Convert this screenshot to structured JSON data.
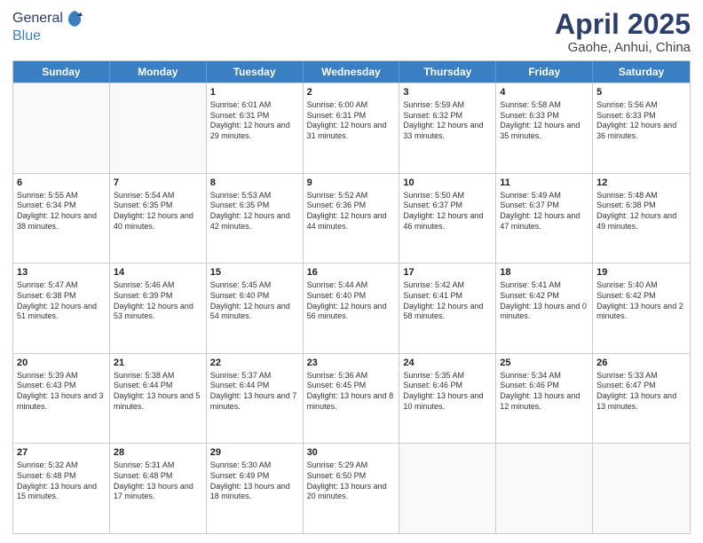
{
  "header": {
    "logo": {
      "general": "General",
      "blue": "Blue"
    },
    "title": "April 2025",
    "location": "Gaohe, Anhui, China"
  },
  "calendar": {
    "days": [
      "Sunday",
      "Monday",
      "Tuesday",
      "Wednesday",
      "Thursday",
      "Friday",
      "Saturday"
    ],
    "rows": [
      [
        {
          "day": "",
          "empty": true
        },
        {
          "day": "",
          "empty": true
        },
        {
          "day": "1",
          "sunrise": "Sunrise: 6:01 AM",
          "sunset": "Sunset: 6:31 PM",
          "daylight": "Daylight: 12 hours and 29 minutes."
        },
        {
          "day": "2",
          "sunrise": "Sunrise: 6:00 AM",
          "sunset": "Sunset: 6:31 PM",
          "daylight": "Daylight: 12 hours and 31 minutes."
        },
        {
          "day": "3",
          "sunrise": "Sunrise: 5:59 AM",
          "sunset": "Sunset: 6:32 PM",
          "daylight": "Daylight: 12 hours and 33 minutes."
        },
        {
          "day": "4",
          "sunrise": "Sunrise: 5:58 AM",
          "sunset": "Sunset: 6:33 PM",
          "daylight": "Daylight: 12 hours and 35 minutes."
        },
        {
          "day": "5",
          "sunrise": "Sunrise: 5:56 AM",
          "sunset": "Sunset: 6:33 PM",
          "daylight": "Daylight: 12 hours and 36 minutes."
        }
      ],
      [
        {
          "day": "6",
          "sunrise": "Sunrise: 5:55 AM",
          "sunset": "Sunset: 6:34 PM",
          "daylight": "Daylight: 12 hours and 38 minutes."
        },
        {
          "day": "7",
          "sunrise": "Sunrise: 5:54 AM",
          "sunset": "Sunset: 6:35 PM",
          "daylight": "Daylight: 12 hours and 40 minutes."
        },
        {
          "day": "8",
          "sunrise": "Sunrise: 5:53 AM",
          "sunset": "Sunset: 6:35 PM",
          "daylight": "Daylight: 12 hours and 42 minutes."
        },
        {
          "day": "9",
          "sunrise": "Sunrise: 5:52 AM",
          "sunset": "Sunset: 6:36 PM",
          "daylight": "Daylight: 12 hours and 44 minutes."
        },
        {
          "day": "10",
          "sunrise": "Sunrise: 5:50 AM",
          "sunset": "Sunset: 6:37 PM",
          "daylight": "Daylight: 12 hours and 46 minutes."
        },
        {
          "day": "11",
          "sunrise": "Sunrise: 5:49 AM",
          "sunset": "Sunset: 6:37 PM",
          "daylight": "Daylight: 12 hours and 47 minutes."
        },
        {
          "day": "12",
          "sunrise": "Sunrise: 5:48 AM",
          "sunset": "Sunset: 6:38 PM",
          "daylight": "Daylight: 12 hours and 49 minutes."
        }
      ],
      [
        {
          "day": "13",
          "sunrise": "Sunrise: 5:47 AM",
          "sunset": "Sunset: 6:38 PM",
          "daylight": "Daylight: 12 hours and 51 minutes."
        },
        {
          "day": "14",
          "sunrise": "Sunrise: 5:46 AM",
          "sunset": "Sunset: 6:39 PM",
          "daylight": "Daylight: 12 hours and 53 minutes."
        },
        {
          "day": "15",
          "sunrise": "Sunrise: 5:45 AM",
          "sunset": "Sunset: 6:40 PM",
          "daylight": "Daylight: 12 hours and 54 minutes."
        },
        {
          "day": "16",
          "sunrise": "Sunrise: 5:44 AM",
          "sunset": "Sunset: 6:40 PM",
          "daylight": "Daylight: 12 hours and 56 minutes."
        },
        {
          "day": "17",
          "sunrise": "Sunrise: 5:42 AM",
          "sunset": "Sunset: 6:41 PM",
          "daylight": "Daylight: 12 hours and 58 minutes."
        },
        {
          "day": "18",
          "sunrise": "Sunrise: 5:41 AM",
          "sunset": "Sunset: 6:42 PM",
          "daylight": "Daylight: 13 hours and 0 minutes."
        },
        {
          "day": "19",
          "sunrise": "Sunrise: 5:40 AM",
          "sunset": "Sunset: 6:42 PM",
          "daylight": "Daylight: 13 hours and 2 minutes."
        }
      ],
      [
        {
          "day": "20",
          "sunrise": "Sunrise: 5:39 AM",
          "sunset": "Sunset: 6:43 PM",
          "daylight": "Daylight: 13 hours and 3 minutes."
        },
        {
          "day": "21",
          "sunrise": "Sunrise: 5:38 AM",
          "sunset": "Sunset: 6:44 PM",
          "daylight": "Daylight: 13 hours and 5 minutes."
        },
        {
          "day": "22",
          "sunrise": "Sunrise: 5:37 AM",
          "sunset": "Sunset: 6:44 PM",
          "daylight": "Daylight: 13 hours and 7 minutes."
        },
        {
          "day": "23",
          "sunrise": "Sunrise: 5:36 AM",
          "sunset": "Sunset: 6:45 PM",
          "daylight": "Daylight: 13 hours and 8 minutes."
        },
        {
          "day": "24",
          "sunrise": "Sunrise: 5:35 AM",
          "sunset": "Sunset: 6:46 PM",
          "daylight": "Daylight: 13 hours and 10 minutes."
        },
        {
          "day": "25",
          "sunrise": "Sunrise: 5:34 AM",
          "sunset": "Sunset: 6:46 PM",
          "daylight": "Daylight: 13 hours and 12 minutes."
        },
        {
          "day": "26",
          "sunrise": "Sunrise: 5:33 AM",
          "sunset": "Sunset: 6:47 PM",
          "daylight": "Daylight: 13 hours and 13 minutes."
        }
      ],
      [
        {
          "day": "27",
          "sunrise": "Sunrise: 5:32 AM",
          "sunset": "Sunset: 6:48 PM",
          "daylight": "Daylight: 13 hours and 15 minutes."
        },
        {
          "day": "28",
          "sunrise": "Sunrise: 5:31 AM",
          "sunset": "Sunset: 6:48 PM",
          "daylight": "Daylight: 13 hours and 17 minutes."
        },
        {
          "day": "29",
          "sunrise": "Sunrise: 5:30 AM",
          "sunset": "Sunset: 6:49 PM",
          "daylight": "Daylight: 13 hours and 18 minutes."
        },
        {
          "day": "30",
          "sunrise": "Sunrise: 5:29 AM",
          "sunset": "Sunset: 6:50 PM",
          "daylight": "Daylight: 13 hours and 20 minutes."
        },
        {
          "day": "",
          "empty": true
        },
        {
          "day": "",
          "empty": true
        },
        {
          "day": "",
          "empty": true
        }
      ]
    ]
  }
}
